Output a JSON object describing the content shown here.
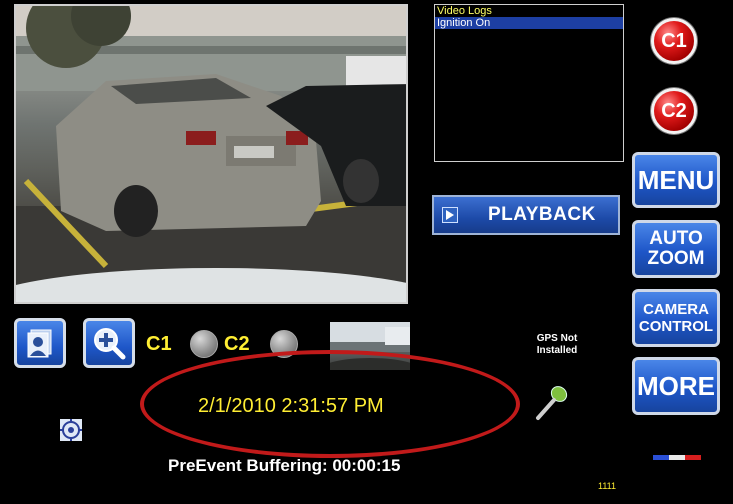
{
  "logs": {
    "items": [
      "Video Logs",
      "Ignition On"
    ],
    "selected_index": 1
  },
  "buttons": {
    "c1": "C1",
    "c2": "C2",
    "menu": "MENU",
    "auto_zoom": [
      "AUTO",
      "ZOOM"
    ],
    "camera_control": [
      "CAMERA",
      "CONTROL"
    ],
    "more": "MORE",
    "playback": "PLAYBACK"
  },
  "camera_labels": {
    "c1": "C1",
    "c2": "C2"
  },
  "gps": {
    "line1": "GPS Not",
    "line2": "Installed"
  },
  "timestamp": "2/1/2010 2:31:57 PM",
  "buffer_status": "PreEvent Buffering: 00:00:15",
  "code": "1111",
  "colors": {
    "background": "#000000",
    "accent_blue": "#1e56c8",
    "record_red": "#e01a1a",
    "highlight_yellow": "#ffee33",
    "annotation_ring": "#c11a1a"
  },
  "icons": [
    "play-icon",
    "contacts-icon",
    "zoom-in-icon",
    "target-icon",
    "microphone-icon",
    "indicator-bars-icon"
  ]
}
